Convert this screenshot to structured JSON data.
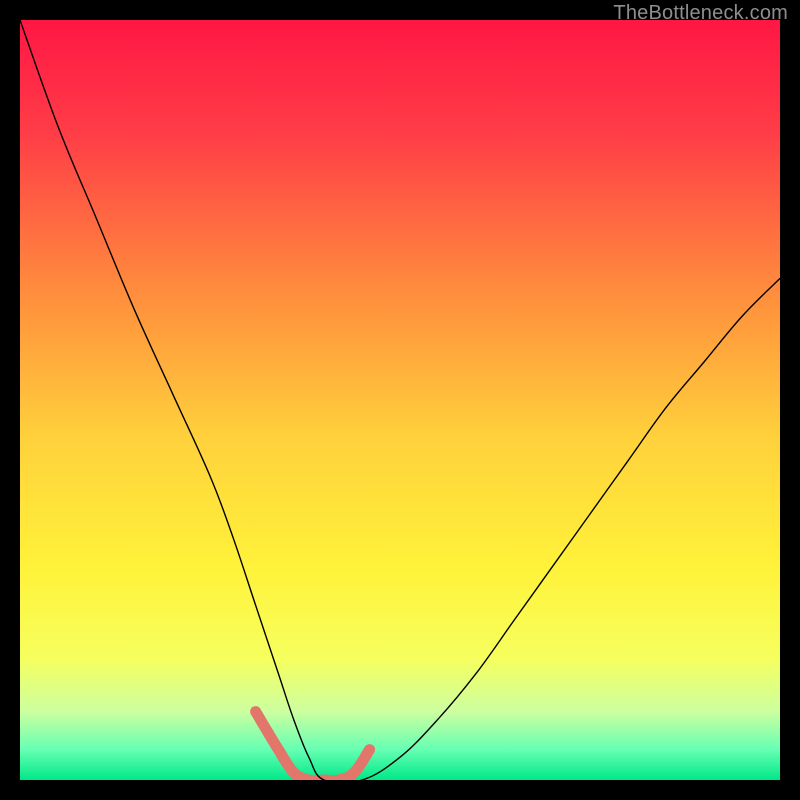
{
  "watermark": "TheBottleneck.com",
  "chart_data": {
    "type": "line",
    "title": "",
    "xlabel": "",
    "ylabel": "",
    "xlim": [
      0,
      100
    ],
    "ylim": [
      0,
      100
    ],
    "background_gradient": {
      "stops": [
        {
          "pos": 0.0,
          "color": "#ff1744"
        },
        {
          "pos": 0.15,
          "color": "#ff3d47"
        },
        {
          "pos": 0.35,
          "color": "#ff8a3d"
        },
        {
          "pos": 0.55,
          "color": "#ffd13b"
        },
        {
          "pos": 0.72,
          "color": "#fff23a"
        },
        {
          "pos": 0.84,
          "color": "#f6ff5e"
        },
        {
          "pos": 0.91,
          "color": "#ccffa0"
        },
        {
          "pos": 0.96,
          "color": "#66ffb3"
        },
        {
          "pos": 1.0,
          "color": "#00e888"
        }
      ]
    },
    "series": [
      {
        "name": "bottleneck-curve",
        "color": "#000000",
        "width": 1.4,
        "x": [
          0,
          5,
          10,
          15,
          20,
          25,
          28,
          31,
          34,
          36,
          38,
          40,
          45,
          50,
          55,
          60,
          65,
          70,
          75,
          80,
          85,
          90,
          95,
          100
        ],
        "values": [
          100,
          86,
          74,
          62,
          51,
          40,
          32,
          23,
          14,
          8,
          3,
          0,
          0,
          3,
          8,
          14,
          21,
          28,
          35,
          42,
          49,
          55,
          61,
          66
        ]
      }
    ],
    "highlight_band": {
      "name": "optimal-range",
      "color": "#e2766b",
      "width": 11,
      "cap": "round",
      "x": [
        31,
        34,
        36,
        38,
        40,
        42,
        44,
        46
      ],
      "values": [
        9,
        4,
        1,
        0,
        0,
        0,
        1,
        4
      ]
    }
  }
}
